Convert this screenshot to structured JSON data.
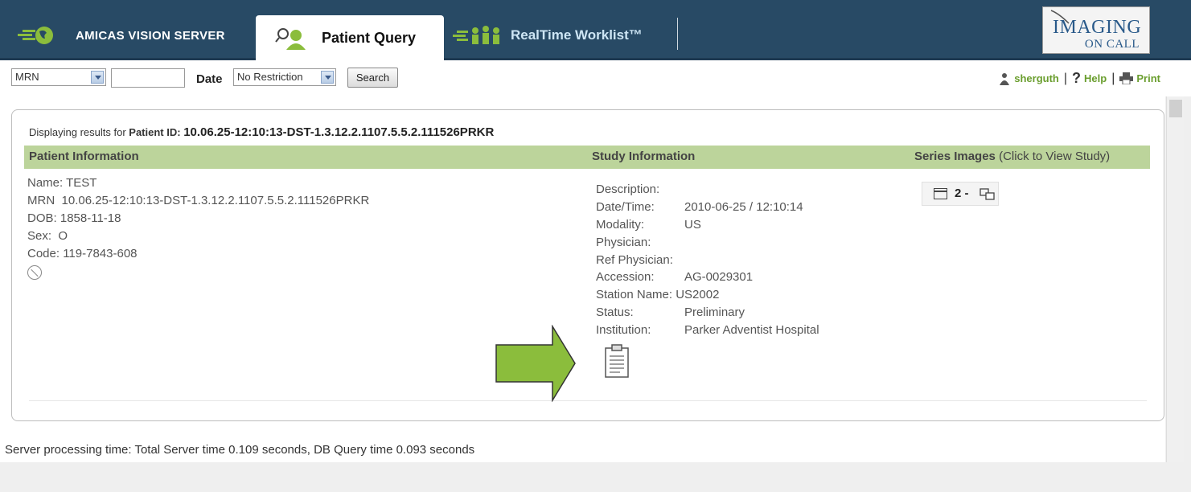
{
  "nav": {
    "brand": "AMICAS VISION SERVER",
    "tab_active": "Patient Query",
    "tab_worklist": "RealTime Worklist™",
    "logo_line1": "IMAGING",
    "logo_line2": "ON CALL"
  },
  "toolbar": {
    "field_select": "MRN",
    "search_value": "",
    "date_label": "Date",
    "date_select": "No Restriction",
    "search_button": "Search",
    "user": "sherguth",
    "help": "Help",
    "print": "Print"
  },
  "results": {
    "prefix": "Displaying results for",
    "pid_label": "Patient ID:",
    "pid_value": "10.06.25-12:10:13-DST-1.3.12.2.1107.5.5.2.111526PRKR"
  },
  "headers": {
    "patient": "Patient Information",
    "study": "Study Information",
    "series": "Series Images",
    "series_sub": "(Click to View Study)"
  },
  "patient": {
    "name_k": "Name:",
    "name_v": "TEST",
    "mrn_k": "MRN",
    "mrn_v": "10.06.25-12:10:13-DST-1.3.12.2.1107.5.5.2.111526PRKR",
    "dob_k": "DOB:",
    "dob_v": "1858-11-18",
    "sex_k": "Sex:",
    "sex_v": "O",
    "code_k": "Code:",
    "code_v": "119-7843-608"
  },
  "study": {
    "description_k": "Description:",
    "description_v": "",
    "datetime_k": "Date/Time:",
    "datetime_v": "2010-06-25 / 12:10:14",
    "modality_k": "Modality:",
    "modality_v": "US",
    "physician_k": "Physician:",
    "physician_v": "",
    "ref_physician_k": "Ref Physician:",
    "ref_physician_v": "",
    "accession_k": "Accession:",
    "accession_v": "AG-0029301",
    "station_k": "Station Name:",
    "station_v": "US2002",
    "status_k": "Status:",
    "status_v": "Preliminary",
    "institution_k": "Institution:",
    "institution_v": "Parker Adventist Hospital"
  },
  "series": {
    "count": "2 -"
  },
  "footer": {
    "server_time": "Server processing time: Total Server time 0.109 seconds, DB Query time 0.093 seconds"
  },
  "colors": {
    "nav_bg": "#284a65",
    "header_band": "#bcd49b",
    "link_green": "#6a9e2e",
    "arrow_green": "#8bbd3c"
  },
  "icons": [
    "person-search-icon",
    "people-icon",
    "user-icon",
    "help-icon",
    "print-icon",
    "report-icon",
    "series-window-icon",
    "expand-icon",
    "patient-link-icon",
    "arrow-icon"
  ]
}
